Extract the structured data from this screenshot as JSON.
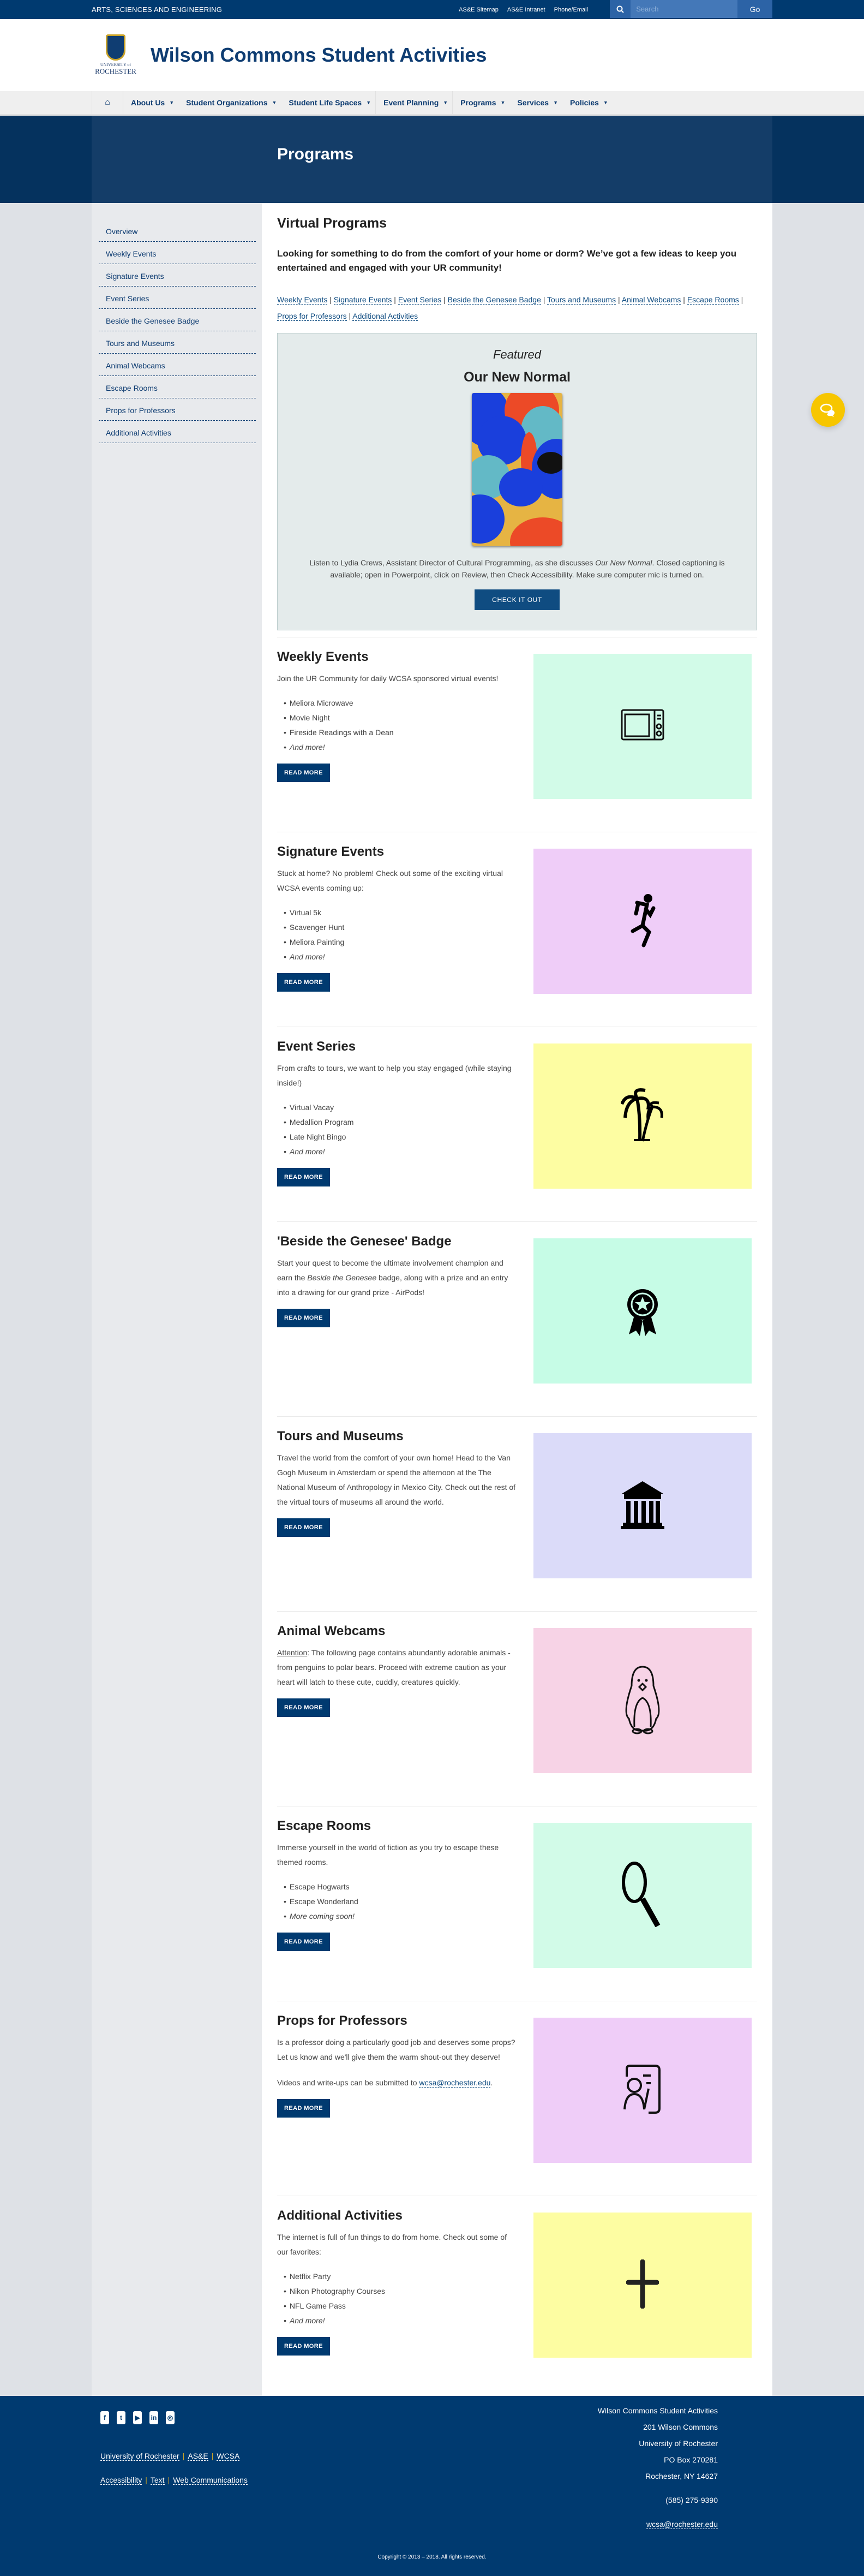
{
  "topbar": {
    "school": "ARTS, SCIENCES AND ENGINEERING",
    "links": [
      "AS&E Sitemap",
      "AS&E Intranet",
      "Phone/Email"
    ],
    "search_placeholder": "Search",
    "go_label": "Go"
  },
  "header": {
    "logo_univ": "UNIVERSITY of",
    "logo_name": "ROCHESTER",
    "site_title": "Wilson Commons Student Activities"
  },
  "nav": {
    "items": [
      "About Us",
      "Student Organizations",
      "Student Life Spaces",
      "Event Planning",
      "Programs",
      "Services",
      "Policies"
    ],
    "caret": "▼"
  },
  "hero": {
    "title": "Programs"
  },
  "sidebar": {
    "items": [
      "Overview",
      "Weekly Events",
      "Signature Events",
      "Event Series",
      "Beside the Genesee Badge",
      "Tours and Museums",
      "Animal Webcams",
      "Escape Rooms",
      "Props for Professors",
      "Additional Activities"
    ]
  },
  "main": {
    "title": "Virtual Programs",
    "intro": "Looking for something to do from the comfort of your home or dorm? We’ve got a few ideas to keep you entertained and engaged with your UR community!",
    "jump_links": [
      "Weekly Events",
      "Signature Events",
      "Event Series",
      "Beside the Genesee Badge",
      "Tours and Museums",
      "Animal Webcams",
      "Escape Rooms",
      "Props for Professors",
      "Additional Activities"
    ],
    "jump_sep": " | ",
    "featured": {
      "kicker": "Featured",
      "title": "Our New Normal",
      "desc_pre": "Listen to Lydia Crews, Assistant Director of Cultural Programming, as she discusses ",
      "desc_em": "Our New Normal",
      "desc_post": ". Closed captioning is available; open in Powerpoint, click on Review, then Check Accessibility. Make sure computer mic is turned on.",
      "button": "CHECK IT OUT"
    },
    "read_more": "READ MORE",
    "sections": [
      {
        "title": "Weekly Events",
        "text": "Join the UR Community for daily WCSA sponsored virtual events!",
        "items": [
          "Meliora Microwave",
          "Movie Night",
          "Fireside Readings with a Dean"
        ],
        "more": "And more!",
        "tile_color": "#d2fbe8",
        "icon": "microwave-icon"
      },
      {
        "title": "Signature Events",
        "text": "Stuck at home? No problem! Check out some of the exciting virtual WCSA events coming up:",
        "items": [
          "Virtual 5k",
          "Scavenger Hunt",
          "Meliora Painting"
        ],
        "more": "And more!",
        "tile_color": "#efcdf8",
        "icon": "runner-icon"
      },
      {
        "title": "Event Series",
        "text": "From crafts to tours, we want to help you stay engaged (while staying inside!)",
        "items": [
          "Virtual Vacay",
          "Medallion Program",
          "Late Night Bingo"
        ],
        "more": "And more!",
        "tile_color": "#fdfda2",
        "icon": "palm-tree-icon"
      },
      {
        "title": "'Beside the Genesee' Badge",
        "text_pre": "Start your quest to become the ultimate involvement champion and earn the ",
        "text_em": "Beside the Genesee",
        "text_post": " badge, along with a prize and an entry into a drawing for our grand prize - AirPods!",
        "tile_color": "#c6fce6",
        "icon": "award-ribbon-icon"
      },
      {
        "title": "Tours and Museums",
        "text": "Travel the world from the comfort of your own home! Head to the Van Gogh Museum in Amsterdam or spend the afternoon at the The National Museum of Anthropology in Mexico City. Check out the rest of the virtual tours of museums all around the world.",
        "tile_color": "#dbdbf9",
        "icon": "museum-icon"
      },
      {
        "title": "Animal Webcams",
        "attention": "Attention",
        "text": ": The following page contains abundantly adorable animals - from penguins to polar bears. Proceed with extreme caution as your heart will latch to these cute, cuddly, creatures quickly.",
        "tile_color": "#f7d3e6",
        "icon": "penguin-icon"
      },
      {
        "title": "Escape Rooms",
        "text": "Immerse yourself in the world of fiction as you try to escape these themed rooms.",
        "items": [
          "Escape Hogwarts",
          "Escape Wonderland"
        ],
        "more": "More coming soon!",
        "tile_color": "#d2fbe8",
        "icon": "magnifier-icon"
      },
      {
        "title": "Props for Professors",
        "text": "Is a professor doing a particularly good job and deserves some props? Let us know and we'll give them the warm shout-out they deserve!",
        "text2": "Videos and write-ups can be submitted to",
        "email": "wcsa@rochester.edu",
        "email_suffix": ".",
        "tile_color": "#efcdf8",
        "icon": "presenter-icon"
      },
      {
        "title": "Additional Activities",
        "text": "The internet is full of fun things to do from home. Check out some of our favorites:",
        "items": [
          "Netflix Party",
          "Nikon Photography Courses",
          "NFL Game Pass"
        ],
        "more": "And more!",
        "tile_color": "#fdfda2",
        "icon": "plus-icon"
      }
    ]
  },
  "footer": {
    "social": [
      "facebook-icon",
      "twitter-icon",
      "youtube-icon",
      "linkedin-icon",
      "instagram-icon"
    ],
    "links_row1": [
      "University of Rochester",
      "AS&E",
      "WCSA"
    ],
    "links_row2": [
      "Accessibility",
      "Text",
      "Web Communications"
    ],
    "address": [
      "Wilson Commons Student Activities",
      "201 Wilson Commons",
      "University of Rochester",
      "PO Box 270281",
      "Rochester, NY 14627"
    ],
    "phone": "(585) 275-9390",
    "email": "wcsa@rochester.edu",
    "copyright": "Copyright © 2013 – 2018. All rights reserved."
  },
  "colors": {
    "brand": "#003a70",
    "accent_gold": "#c9a227",
    "chat": "#f7c600"
  }
}
